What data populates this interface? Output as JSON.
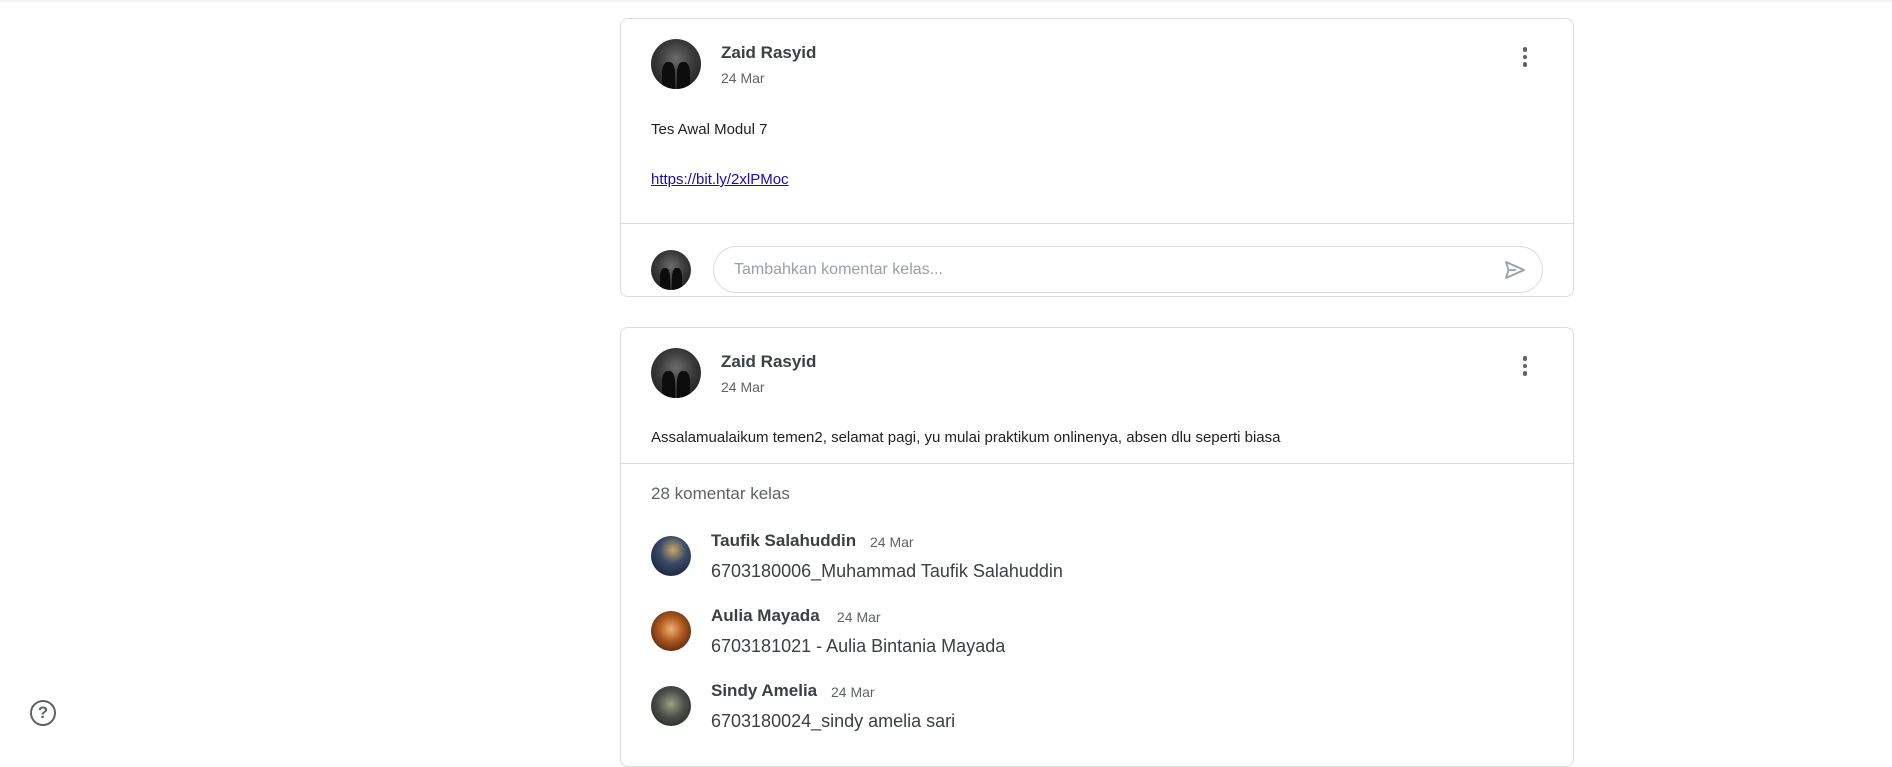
{
  "posts": [
    {
      "author": "Zaid Rasyid",
      "date": "24 Mar",
      "text": "Tes Awal Modul 7",
      "link": "https://bit.ly/2xlPMoc",
      "comment_placeholder": "Tambahkan komentar kelas..."
    },
    {
      "author": "Zaid Rasyid",
      "date": "24 Mar",
      "text": "Assalamualaikum temen2, selamat pagi, yu mulai praktikum onlinenya, absen dlu seperti biasa",
      "comment_count": "28 komentar kelas",
      "comments": [
        {
          "name": "Taufik Salahuddin",
          "date": "24 Mar",
          "text": "6703180006_Muhammad Taufik Salahuddin"
        },
        {
          "name": "Aulia Mayada",
          "date": "24 Mar",
          "text": "6703181021 - Aulia Bintania Mayada"
        },
        {
          "name": "Sindy Amelia",
          "date": "24 Mar",
          "text": "6703180024_sindy amelia sari"
        }
      ]
    }
  ],
  "icons": {
    "more": "more-vert-icon",
    "send": "send-icon",
    "help": "help-icon"
  },
  "colors": {
    "link": "#1a0dab",
    "border": "#dadce0",
    "secondary_text": "#5f6368"
  }
}
